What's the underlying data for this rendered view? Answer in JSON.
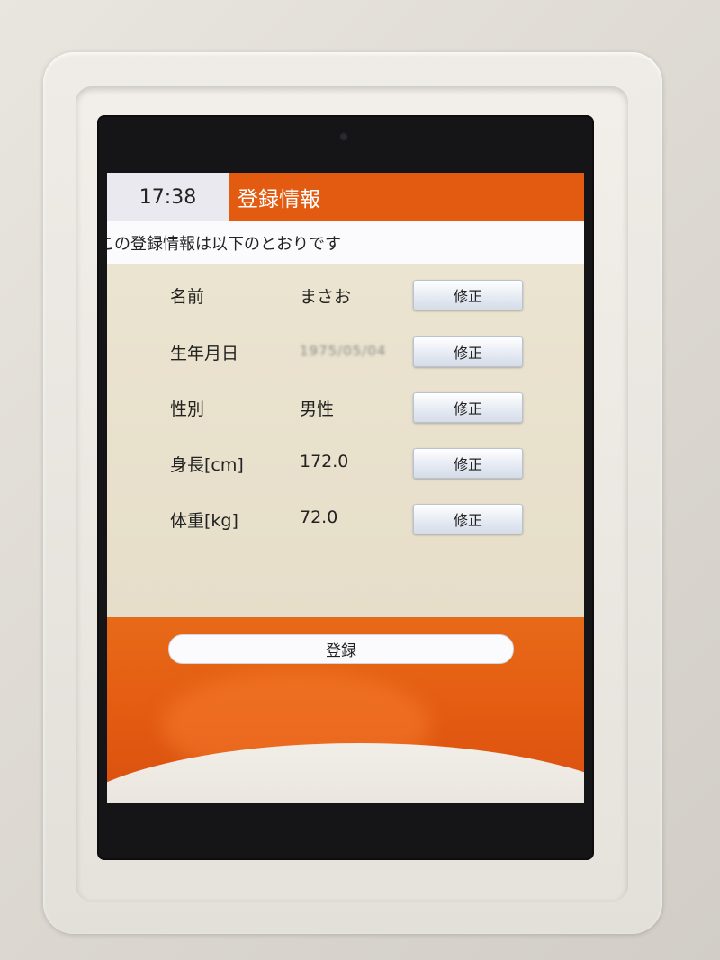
{
  "status": {
    "time": "17:38"
  },
  "header": {
    "title": "登録情報"
  },
  "subtitle": "この登録情報は以下のとおりです",
  "fields": [
    {
      "label": "名前",
      "value": "まさお",
      "edit_label": "修正"
    },
    {
      "label": "生年月日",
      "value": "1975/05/04",
      "edit_label": "修正"
    },
    {
      "label": "性別",
      "value": "男性",
      "edit_label": "修正"
    },
    {
      "label": "身長[cm]",
      "value": "172.0",
      "edit_label": "修正"
    },
    {
      "label": "体重[kg]",
      "value": "72.0",
      "edit_label": "修正"
    }
  ],
  "footer": {
    "register_label": "登録"
  },
  "colors": {
    "accent": "#e35b10",
    "content_bg": "#e6dec9",
    "clock_bg": "#e9e9ef"
  }
}
